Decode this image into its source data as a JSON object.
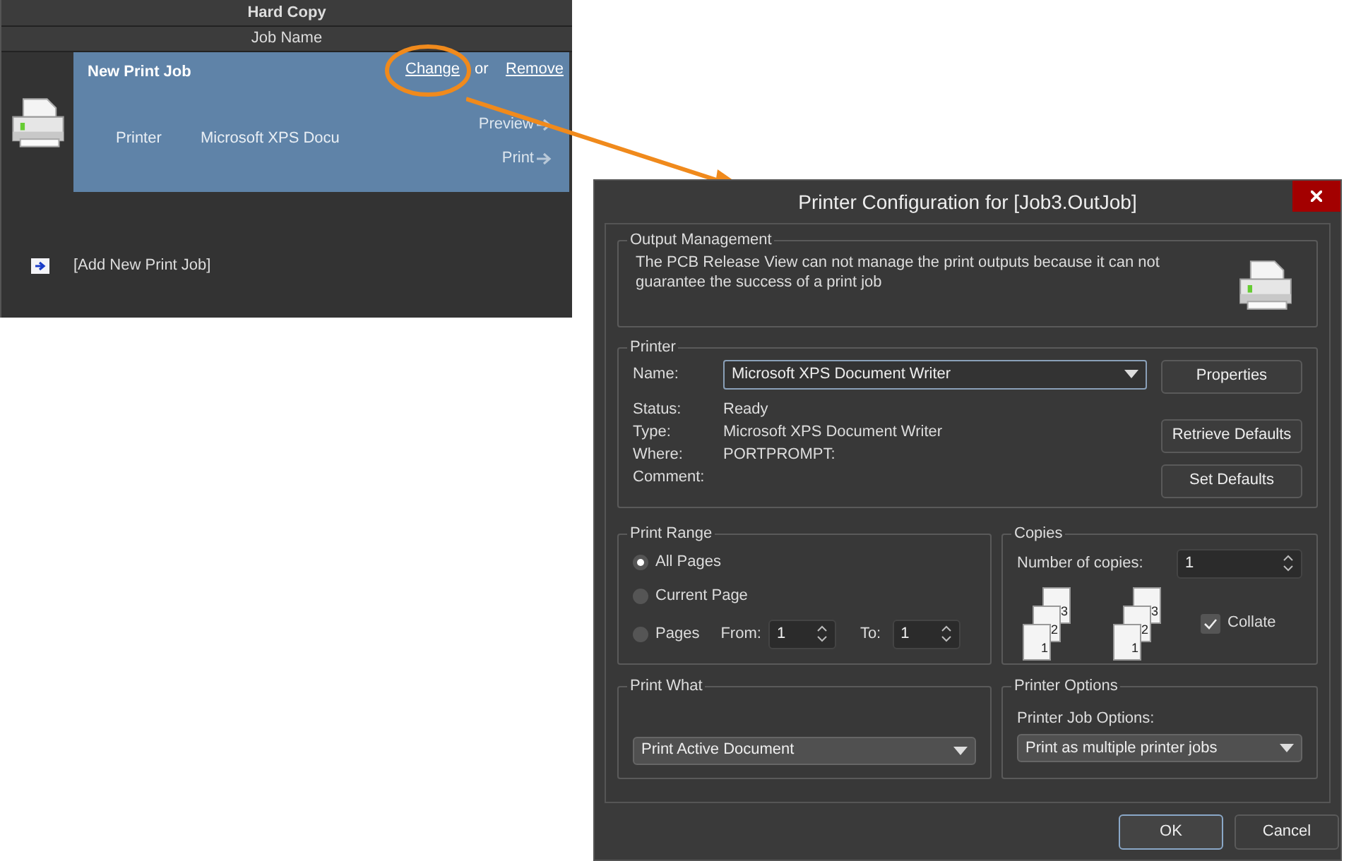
{
  "job_panel": {
    "header": "Hard Copy",
    "column": "Job Name",
    "jobs": [
      {
        "name": "New Print Job",
        "change": "Change",
        "or": "or",
        "remove": "Remove",
        "printer_label": "Printer",
        "printer": "Microsoft XPS Docu",
        "preview": "Preview",
        "print": "Print",
        "selected": true
      }
    ],
    "add_job": "[Add New Print Job]"
  },
  "dialog": {
    "title": "Printer Configuration for [Job3.OutJob]",
    "output_management": {
      "title": "Output Management",
      "message": "The PCB Release View can not manage the print outputs because it can not guarantee the success of a print job"
    },
    "printer": {
      "title": "Printer",
      "name_label": "Name:",
      "name_value": "Microsoft XPS Document Writer",
      "fields": [
        {
          "label": "Status:",
          "value": "Ready"
        },
        {
          "label": "Type:",
          "value": "Microsoft XPS Document Writer"
        },
        {
          "label": "Where:",
          "value": "PORTPROMPT:"
        },
        {
          "label": "Comment:"
        }
      ],
      "buttons": [
        "Properties",
        "Retrieve Defaults",
        "Set Defaults"
      ]
    },
    "print_range": {
      "title": "Print Range",
      "options": [
        {
          "label": "All Pages",
          "selected": true
        },
        {
          "label": "Current Page",
          "selected": false
        },
        {
          "label": "Pages",
          "selected": false
        }
      ],
      "from_label": "From:",
      "from": "1",
      "to_label": "To:",
      "to": "1"
    },
    "copies": {
      "title": "Copies",
      "label": "Number of copies:",
      "value": "1",
      "page_stacks": [
        [
          "3",
          "2",
          "1"
        ],
        [
          "3",
          "2",
          "1"
        ]
      ],
      "collate_label": "Collate",
      "collate_checked": true
    },
    "print_what": {
      "title": "Print What",
      "value": "Print Active Document"
    },
    "printer_options": {
      "title": "Printer Options",
      "label": "Printer Job Options:",
      "value": "Print as multiple printer jobs"
    },
    "buttons": [
      {
        "label": "OK",
        "default": true
      },
      {
        "label": "Cancel",
        "default": false
      }
    ]
  }
}
